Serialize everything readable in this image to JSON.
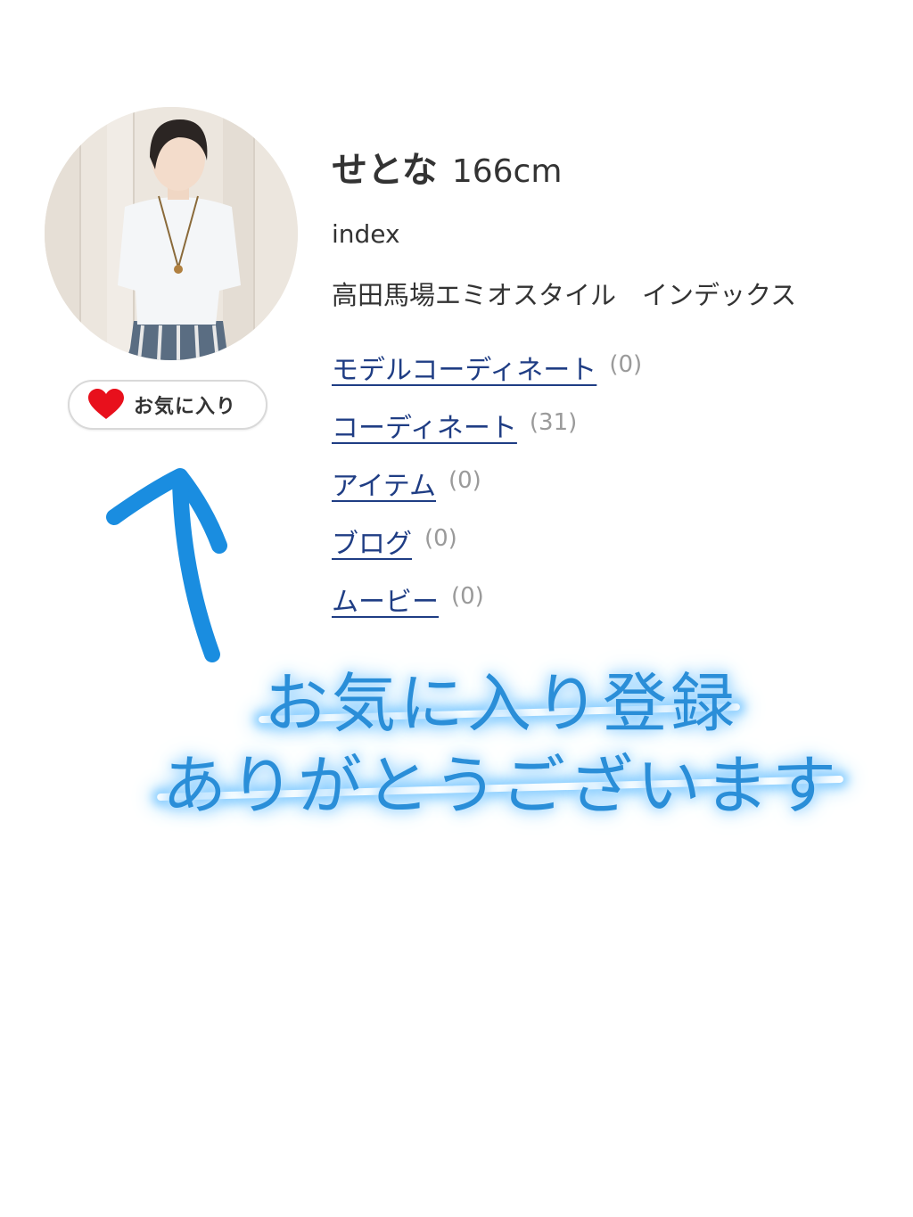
{
  "profile": {
    "name": "せとな",
    "height": "166cm",
    "shop_code": "index",
    "shop_name": "高田馬場エミオスタイル　インデックス",
    "avatar": "staff-photo"
  },
  "favorite_button": {
    "icon": "heart-icon",
    "label": "お気に入り",
    "icon_color": "#e8101c"
  },
  "nav": [
    {
      "label": "モデルコーディネート",
      "count": "(0)"
    },
    {
      "label": "コーディネート",
      "count": "(31)"
    },
    {
      "label": "アイテム",
      "count": "(0)"
    },
    {
      "label": "ブログ",
      "count": "(0)"
    },
    {
      "label": "ムービー",
      "count": "(0)"
    }
  ],
  "annotation": {
    "line1": "お気に入り登録",
    "line2": "ありがとうございます",
    "color": "#2a8ed8",
    "arrow_icon": "arrow-up-icon"
  },
  "colors": {
    "link": "#1f3d84",
    "count": "#9a9a9a",
    "text": "#333333"
  }
}
